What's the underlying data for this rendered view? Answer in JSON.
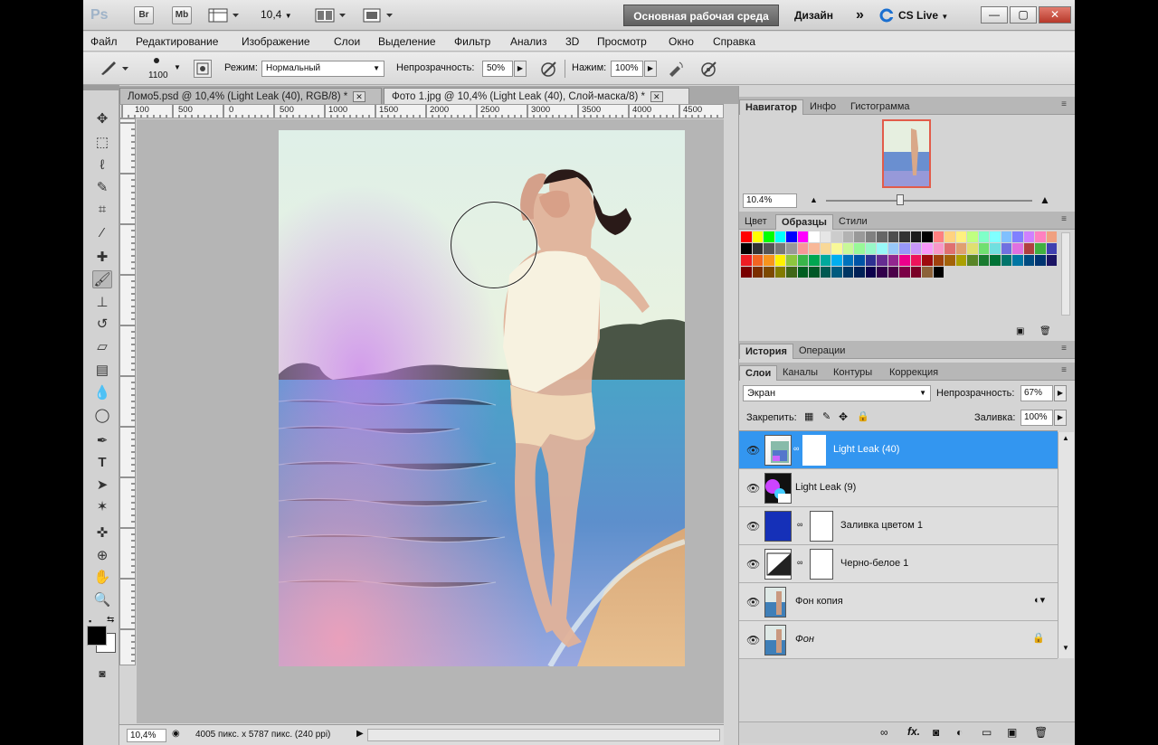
{
  "appbar": {
    "logo": "Ps",
    "btn_br": "Br",
    "btn_mb": "Mb",
    "zoom": "10,4",
    "workspace": "Основная рабочая среда",
    "design": "Дизайн",
    "more": "»",
    "cslive": "CS Live",
    "min": "—",
    "max": "▢",
    "close": "✕"
  },
  "menu": {
    "items": [
      "Файл",
      "Редактирование",
      "Изображение",
      "Слои",
      "Выделение",
      "Фильтр",
      "Анализ",
      "3D",
      "Просмотр",
      "Окно",
      "Справка"
    ]
  },
  "options": {
    "brush_size": "1100",
    "mode_label": "Режим:",
    "mode_value": "Нормальный",
    "opacity_label": "Непрозрачность:",
    "opacity_value": "50%",
    "pressure_label": "Нажим:",
    "pressure_value": "100%"
  },
  "tabs": [
    {
      "label": "Ломо5.psd @ 10,4% (Light Leak (40), RGB/8) *",
      "close": "✕"
    },
    {
      "label": "Фото 1.jpg @ 10,4% (Light Leak (40), Слой-маска/8) *",
      "close": "✕"
    }
  ],
  "ruler": {
    "ticks": [
      "100",
      "500",
      "0",
      "500",
      "1000",
      "1500",
      "2000",
      "2500",
      "3000",
      "3500",
      "4000",
      "4500"
    ]
  },
  "status": {
    "zoom": "10,4%",
    "doc_info": "4005 пикс. x 5787 пикс. (240 ppi)"
  },
  "navigator": {
    "tabs": [
      "Навигатор",
      "Инфо",
      "Гистограмма"
    ],
    "zoom": "10.4%",
    "zoom_level": 0.36
  },
  "swatches_panel": {
    "tabs": [
      "Цвет",
      "Образцы",
      "Стили"
    ]
  },
  "history_panel": {
    "tabs": [
      "История",
      "Операции"
    ]
  },
  "layers_panel": {
    "tabs": [
      "Слои",
      "Каналы",
      "Контуры",
      "Коррекция"
    ],
    "blend_mode": "Экран",
    "opacity_label": "Непрозрачность:",
    "opacity_value": "67%",
    "lock_label": "Закрепить:",
    "fill_label": "Заливка:",
    "fill_value": "100%",
    "layers": [
      {
        "name": "Light Leak (40)",
        "active": true
      },
      {
        "name": "Light Leak (9)",
        "active": false
      },
      {
        "name": "Заливка цветом 1",
        "active": false
      },
      {
        "name": "Черно-белое 1",
        "active": false
      },
      {
        "name": "Фон копия",
        "active": false
      },
      {
        "name": "Фон",
        "active": false
      }
    ],
    "footer_icons": [
      "link-icon",
      "fx-icon",
      "mask-icon",
      "adjustment-icon",
      "group-icon",
      "new-layer-icon",
      "trash-icon"
    ],
    "fx_label": "fx."
  },
  "colors": {
    "accent": "#3396f0",
    "fill_layer": "#1530b8",
    "foreground": "#000000",
    "background": "#ffffff"
  }
}
